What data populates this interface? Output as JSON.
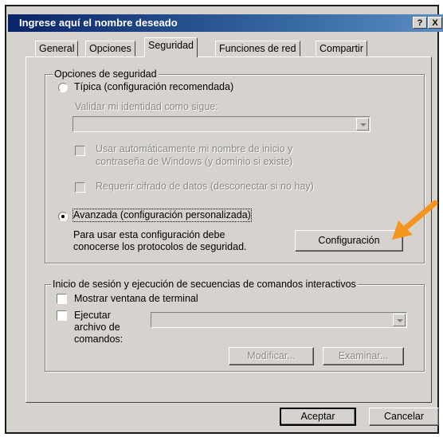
{
  "window": {
    "title": "Ingrese aquí el nombre deseado",
    "help_btn": "?",
    "close_btn": "X"
  },
  "tabs": [
    {
      "label": "General",
      "active": false
    },
    {
      "label": "Opciones",
      "active": false
    },
    {
      "label": "Seguridad",
      "active": true
    },
    {
      "label": "Funciones de red",
      "active": false
    },
    {
      "label": "Compartir",
      "active": false
    }
  ],
  "security": {
    "group_title": "Opciones de seguridad",
    "typical_label": "Típica (configuración recomendada)",
    "typical_selected": false,
    "validate_label": "Validar mi identidad como sigue:",
    "validate_value": "",
    "auto_use_label_1": "Usar automáticamente  mi nombre de inicio y",
    "auto_use_label_2": "contraseña de Windows (y dominio si existe)",
    "require_encryption_label": "Requerir cifrado de datos (desconectar si no hay)",
    "advanced_label": "Avanzada (configuración personalizada)",
    "advanced_selected": true,
    "advanced_desc_1": "Para usar esta configuración debe",
    "advanced_desc_2": "conocerse los protocolos de seguridad.",
    "settings_button": "Configuración"
  },
  "interactive": {
    "group_title": "Inicio de sesión y ejecución de secuencias de comandos interactivos",
    "show_terminal_label": "Mostrar ventana de terminal",
    "show_terminal_checked": false,
    "run_script_label_1": "Ejecutar",
    "run_script_label_2": "archivo de",
    "run_script_label_3": "comandos:",
    "run_script_checked": false,
    "script_value": "",
    "edit_button": "Modificar...",
    "browse_button": "Examinar..."
  },
  "footer": {
    "ok_button": "Aceptar",
    "cancel_button": "Cancelar"
  },
  "annotation": {
    "arrow_color": "#f5941e"
  }
}
